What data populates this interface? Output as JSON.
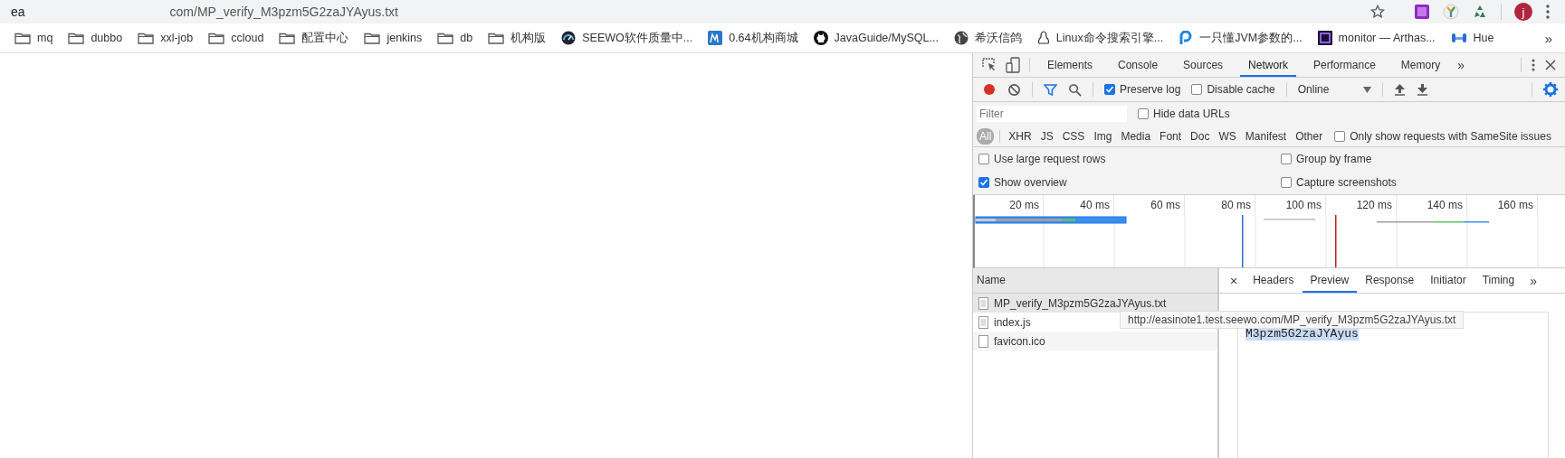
{
  "browser": {
    "address": {
      "host_start": "ea",
      "path": "com/MP_verify_M3pzm5G2zaJYAyus.txt"
    },
    "profile_initial": "j",
    "more_bookmarks": "»",
    "bookmarks": [
      {
        "label": "mq",
        "kind": "folder"
      },
      {
        "label": "dubbo",
        "kind": "folder"
      },
      {
        "label": "xxl-job",
        "kind": "folder"
      },
      {
        "label": "ccloud",
        "kind": "folder"
      },
      {
        "label": "配置中心",
        "kind": "folder"
      },
      {
        "label": "jenkins",
        "kind": "folder"
      },
      {
        "label": "db",
        "kind": "folder"
      },
      {
        "label": "机构版",
        "kind": "folder"
      },
      {
        "label": "SEEWO软件质量中...",
        "kind": "site"
      },
      {
        "label": "0.64机构商城",
        "kind": "site"
      },
      {
        "label": "JavaGuide/MySQL...",
        "kind": "site"
      },
      {
        "label": "希沃信鸽",
        "kind": "site"
      },
      {
        "label": "Linux命令搜索引擎...",
        "kind": "site"
      },
      {
        "label": "一只懂JVM参数的...",
        "kind": "site"
      },
      {
        "label": "monitor — Arthas...",
        "kind": "site"
      },
      {
        "label": "Hue",
        "kind": "site"
      }
    ]
  },
  "devtools": {
    "tabs": [
      {
        "label": "Elements",
        "selected": false
      },
      {
        "label": "Console",
        "selected": false
      },
      {
        "label": "Sources",
        "selected": false
      },
      {
        "label": "Network",
        "selected": true
      },
      {
        "label": "Performance",
        "selected": false
      },
      {
        "label": "Memory",
        "selected": false
      }
    ],
    "more_tabs": "»",
    "toolbar": {
      "recording": true,
      "preserve_log": {
        "label": "Preserve log",
        "checked": true
      },
      "disable_cache": {
        "label": "Disable cache",
        "checked": false
      },
      "throttling": "Online"
    },
    "filter": {
      "placeholder": "Filter",
      "hide_data_urls": {
        "label": "Hide data URLs",
        "checked": false
      }
    },
    "types": [
      {
        "label": "All",
        "selected": true
      },
      {
        "label": "XHR",
        "selected": false
      },
      {
        "label": "JS",
        "selected": false
      },
      {
        "label": "CSS",
        "selected": false
      },
      {
        "label": "Img",
        "selected": false
      },
      {
        "label": "Media",
        "selected": false
      },
      {
        "label": "Font",
        "selected": false
      },
      {
        "label": "Doc",
        "selected": false
      },
      {
        "label": "WS",
        "selected": false
      },
      {
        "label": "Manifest",
        "selected": false
      },
      {
        "label": "Other",
        "selected": false
      }
    ],
    "samesite_only": {
      "label": "Only show requests with SameSite issues",
      "checked": false
    },
    "settings": [
      {
        "label": "Use large request rows",
        "checked": false
      },
      {
        "label": "Group by frame",
        "checked": false
      },
      {
        "label": "Show overview",
        "checked": true
      },
      {
        "label": "Capture screenshots",
        "checked": false
      }
    ],
    "overview_ticks": [
      "20 ms",
      "40 ms",
      "60 ms",
      "80 ms",
      "100 ms",
      "120 ms",
      "140 ms",
      "160 ms"
    ],
    "requests": {
      "column": "Name",
      "rows": [
        {
          "name": "MP_verify_M3pzm5G2zaJYAyus.txt",
          "kind": "document",
          "selected": true
        },
        {
          "name": "index.js",
          "kind": "document",
          "selected": false
        },
        {
          "name": "favicon.ico",
          "kind": "blank",
          "selected": false
        }
      ]
    },
    "detail": {
      "close": "×",
      "tabs": [
        {
          "label": "Headers",
          "selected": false
        },
        {
          "label": "Preview",
          "selected": true
        },
        {
          "label": "Response",
          "selected": false
        },
        {
          "label": "Initiator",
          "selected": false
        },
        {
          "label": "Timing",
          "selected": false
        }
      ],
      "more_tabs": "»",
      "preview_text": "M3pzm5G2zaJYAyus"
    },
    "tooltip": "http://easinote1.test.seewo.com/MP_verify_M3pzm5G2zaJYAyus.txt"
  }
}
